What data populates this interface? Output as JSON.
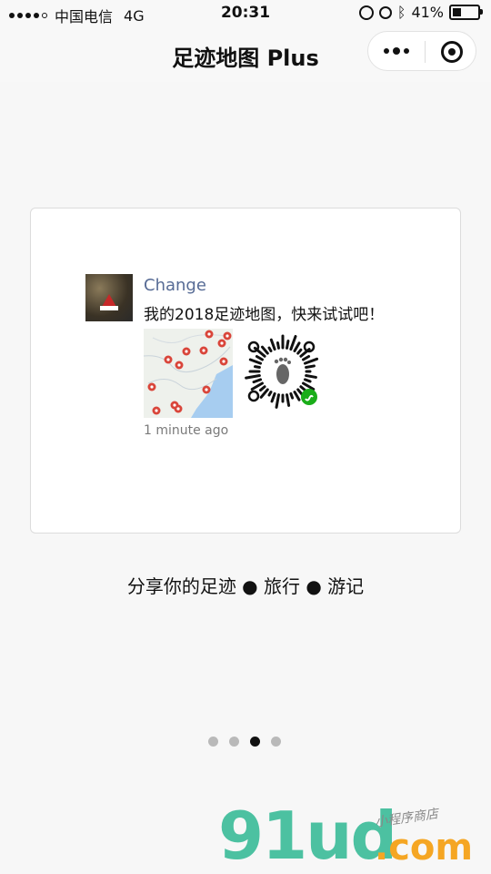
{
  "status_bar": {
    "carrier": "中国电信",
    "network": "4G",
    "time": "20:31",
    "battery": "41%",
    "battery_level": 0.41
  },
  "nav": {
    "title": "足迹地图 Plus"
  },
  "post": {
    "name": "Change",
    "text": "我的2018足迹地图，快来试试吧！",
    "time": "1 minute ago"
  },
  "slogan": "分享你的足迹 ● 旅行 ● 游记",
  "pager": {
    "count": 4,
    "active_index": 2
  },
  "watermark": {
    "main": "91ud",
    "domain": ".com",
    "tagline": "小程序商店"
  },
  "colors": {
    "link_blue": "#576b95",
    "map_marker": "#d9453a",
    "map_sea": "#a7cdf0",
    "wechat_green": "#1aad19",
    "watermark_green": "#4cc1a1",
    "watermark_orange": "#f5a623"
  }
}
